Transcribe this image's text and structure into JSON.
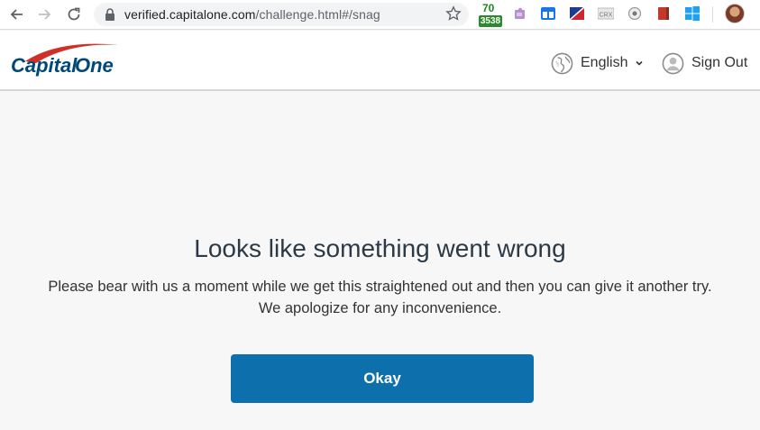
{
  "browser": {
    "url_host": "verified.capitalone.com",
    "url_path": "/challenge.html#/snag",
    "extensions": [
      {
        "name": "badge-extension",
        "top": "70",
        "bottom": "3538"
      },
      {
        "name": "puzzle-extension-icon"
      },
      {
        "name": "window-extension-icon"
      },
      {
        "name": "flag-extension-icon"
      },
      {
        "name": "crx-extension-icon",
        "label": "CRX"
      },
      {
        "name": "target-extension-icon"
      },
      {
        "name": "book-extension-icon"
      },
      {
        "name": "windows-extension-icon"
      }
    ],
    "colors": {
      "omnibox": "#f1f3f4",
      "badge_green": "#2d8a2d"
    }
  },
  "header": {
    "logo_text_capital": "Capital",
    "logo_text_one": "One",
    "language_label": "English",
    "signout_label": "Sign Out"
  },
  "error": {
    "title": "Looks like something went wrong",
    "message": "Please bear with us a moment while we get this straightened out and then you can give it another try. We apologize for any inconvenience.",
    "button_label": "Okay"
  },
  "colors": {
    "brand_red": "#d03027",
    "brand_navy": "#004977",
    "button_blue": "#0d6fab",
    "background": "#f7f7f7"
  }
}
